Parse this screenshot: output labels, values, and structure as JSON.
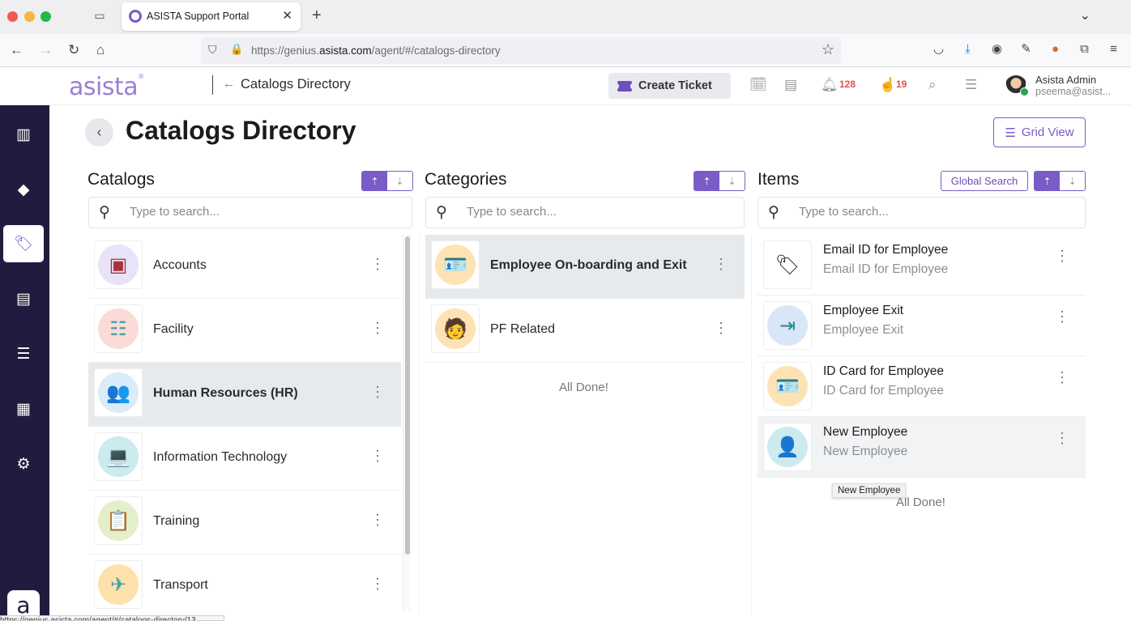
{
  "browser": {
    "tab_title": "ASISTA Support Portal",
    "url_prefix": "https://genius.",
    "url_domain": "asista.com",
    "url_path": "/agent/#/catalogs-directory",
    "status_url": "https://genius.asista.com/agent/#/catalogs-directory/13"
  },
  "header": {
    "logo": "asista",
    "breadcrumb_title": "Catalogs Directory",
    "create_ticket_label": "Create Ticket",
    "notifications_count": "128",
    "tasks_count": "19",
    "user_name": "Asista Admin",
    "user_email": "pseema@asist..."
  },
  "sidebar": {
    "items": [
      {
        "name": "dashboard",
        "icon": "bar-chart-icon",
        "glyph": "▥",
        "active": false
      },
      {
        "name": "tickets",
        "icon": "ticket-icon",
        "glyph": "◆",
        "active": false
      },
      {
        "name": "catalogs",
        "icon": "tag-icon",
        "glyph": "🏷",
        "active": true
      },
      {
        "name": "knowledge-base",
        "icon": "books-icon",
        "glyph": "▤",
        "active": false
      },
      {
        "name": "list",
        "icon": "list-icon",
        "glyph": "☰",
        "active": false
      },
      {
        "name": "reports",
        "icon": "report-icon",
        "glyph": "▦",
        "active": false
      },
      {
        "name": "settings",
        "icon": "gear-icon",
        "glyph": "⚙",
        "active": false
      }
    ],
    "bottom_logo": "a"
  },
  "page": {
    "title": "Catalogs Directory",
    "grid_view_label": "Grid View"
  },
  "catalogs": {
    "title": "Catalogs",
    "search_placeholder": "Type to search...",
    "items": [
      {
        "label": "Accounts",
        "icon": "coins-icon",
        "glyph": "▣",
        "bg": "#e8e3f7",
        "fg": "#a8323f",
        "selected": false
      },
      {
        "label": "Facility",
        "icon": "air-conditioner-icon",
        "glyph": "☷",
        "bg": "#f9dcd7",
        "fg": "#4b9fa6",
        "selected": false
      },
      {
        "label": "Human Resources (HR)",
        "icon": "people-group-icon",
        "glyph": "👥",
        "bg": "#d9ecf7",
        "fg": "#e0894b",
        "selected": true
      },
      {
        "label": "Information Technology",
        "icon": "it-support-icon",
        "glyph": "💻",
        "bg": "#cdeaec",
        "fg": "#3c6b7a",
        "selected": false
      },
      {
        "label": "Training",
        "icon": "presentation-icon",
        "glyph": "📋",
        "bg": "#e3efc9",
        "fg": "#3e7a58",
        "selected": false
      },
      {
        "label": "Transport",
        "icon": "airplane-icon",
        "glyph": "✈",
        "bg": "#fde1ad",
        "fg": "#4b9fa6",
        "selected": false
      }
    ]
  },
  "categories": {
    "title": "Categories",
    "search_placeholder": "Type to search...",
    "items": [
      {
        "label": "Employee On-boarding and Exit",
        "icon": "id-card-icon",
        "glyph": "🪪",
        "bg": "#fde3b4",
        "fg": "#b85a3a",
        "selected": true
      },
      {
        "label": "PF Related",
        "icon": "employee-money-icon",
        "glyph": "🧑",
        "bg": "#fde3b4",
        "fg": "#6a4a2a",
        "selected": false
      }
    ],
    "footer": "All Done!"
  },
  "items": {
    "title": "Items",
    "global_search_label": "Global Search",
    "search_placeholder": "Type to search...",
    "list": [
      {
        "title": "Email ID for Employee",
        "subtitle": "Email ID for Employee",
        "icon": "tag-outline-icon",
        "glyph": "🏷",
        "bg": "#ffffff",
        "fg": "#222",
        "hover": false
      },
      {
        "title": "Employee Exit",
        "subtitle": "Employee Exit",
        "icon": "exit-door-icon",
        "glyph": "⇥",
        "bg": "#d8e6f7",
        "fg": "#1e8a8a",
        "hover": false
      },
      {
        "title": "ID Card for Employee",
        "subtitle": "ID Card for Employee",
        "icon": "id-card-icon",
        "glyph": "🪪",
        "bg": "#fde3b4",
        "fg": "#b85a3a",
        "hover": false
      },
      {
        "title": "New Employee",
        "subtitle": "New Employee",
        "icon": "new-employee-icon",
        "glyph": "👤",
        "bg": "#cdeaf0",
        "fg": "#3e7ca6",
        "hover": true
      }
    ],
    "footer": "All Done!",
    "tooltip": "New Employee"
  },
  "colors": {
    "accent": "#7a5bc7",
    "sidebar_bg": "#231b3f",
    "badge_red": "#d9534f",
    "selected_row": "#e7eaed"
  }
}
